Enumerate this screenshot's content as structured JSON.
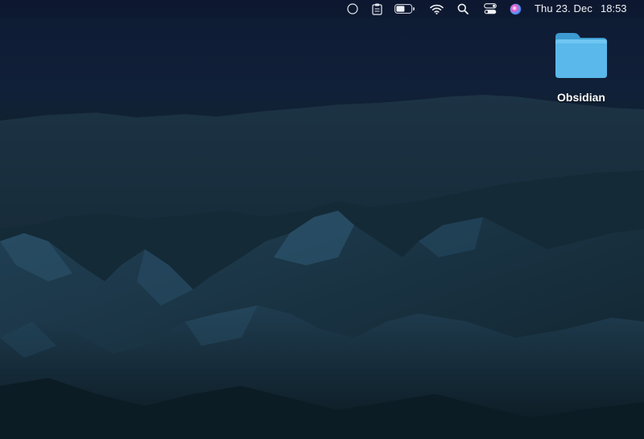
{
  "menubar": {
    "icons": [
      "screen-record-icon",
      "notes-icon",
      "battery-icon",
      "wifi-icon",
      "spotlight-search-icon",
      "control-center-icon",
      "siri-icon"
    ],
    "date": "Thu 23. Dec",
    "time": "18:53"
  },
  "desktop": {
    "folder": {
      "label": "Obsidian",
      "icon": "folder-icon",
      "color": "#5ab8ea"
    }
  },
  "colors": {
    "sky": "#0e1a33",
    "mountains": "#1b3546"
  }
}
